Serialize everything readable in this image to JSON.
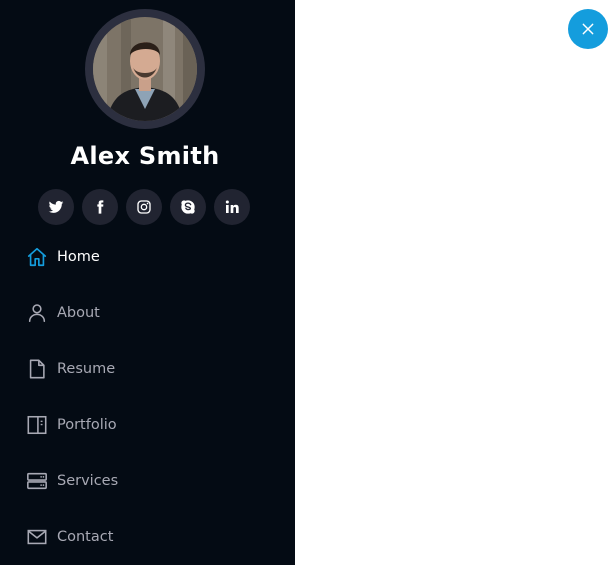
{
  "profile": {
    "name": "Alex Smith",
    "avatar_alt": "profile-photo"
  },
  "social": [
    {
      "name": "twitter-icon"
    },
    {
      "name": "facebook-icon"
    },
    {
      "name": "instagram-icon"
    },
    {
      "name": "skype-icon"
    },
    {
      "name": "linkedin-icon"
    }
  ],
  "nav": {
    "items": [
      {
        "label": "Home",
        "icon": "home-icon",
        "active": true
      },
      {
        "label": "About",
        "icon": "user-icon",
        "active": false
      },
      {
        "label": "Resume",
        "icon": "file-icon",
        "active": false
      },
      {
        "label": "Portfolio",
        "icon": "book-icon",
        "active": false
      },
      {
        "label": "Services",
        "icon": "server-icon",
        "active": false
      },
      {
        "label": "Contact",
        "icon": "envelope-icon",
        "active": false
      }
    ]
  },
  "close_button": {
    "icon": "close-icon"
  },
  "colors": {
    "sidebar_bg": "#040b14",
    "accent": "#149ddd",
    "nav_text": "#a8a9b4",
    "social_bg": "#212431"
  }
}
